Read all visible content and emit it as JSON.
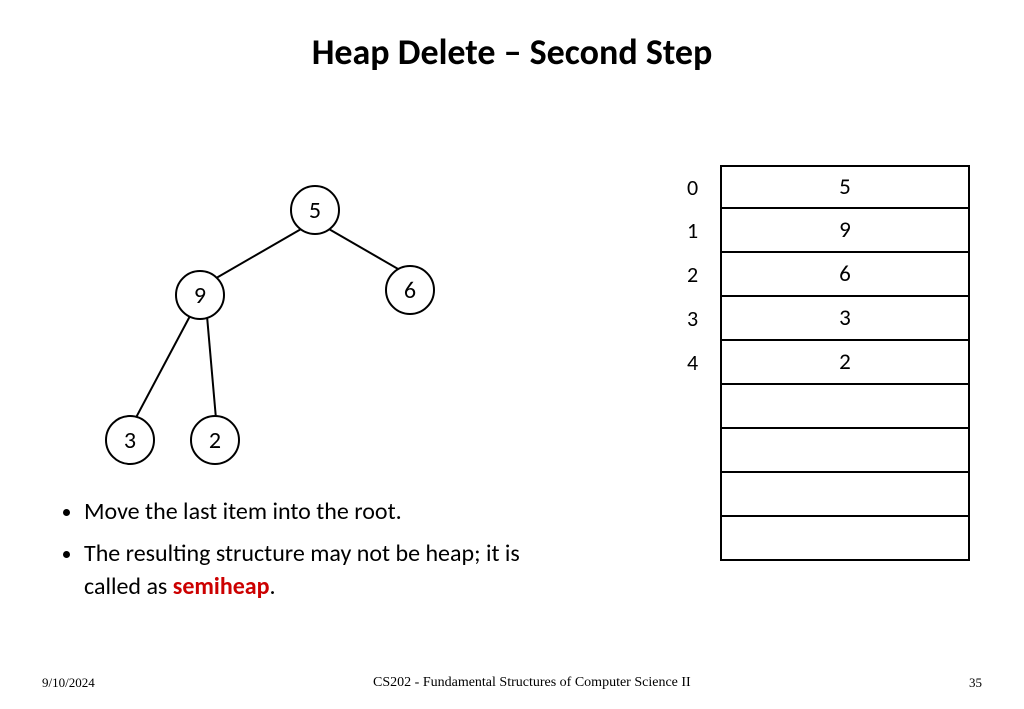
{
  "title": "Heap Delete – Second Step",
  "tree": {
    "root": "5",
    "left": "9",
    "right": "6",
    "leftleft": "3",
    "leftright": "2"
  },
  "array": {
    "indices": [
      "0",
      "1",
      "2",
      "3",
      "4",
      "",
      "",
      "",
      ""
    ],
    "values": [
      "5",
      "9",
      "6",
      "3",
      "2",
      "",
      "",
      "",
      ""
    ]
  },
  "bullets": {
    "b1": "Move the last item into the root.",
    "b2a": "The resulting structure may not be heap; it is called as ",
    "b2b": "semiheap",
    "b2c": "."
  },
  "footer": {
    "date": "9/10/2024",
    "course": "CS202 - Fundamental Structures of Computer Science II",
    "page": "35"
  }
}
